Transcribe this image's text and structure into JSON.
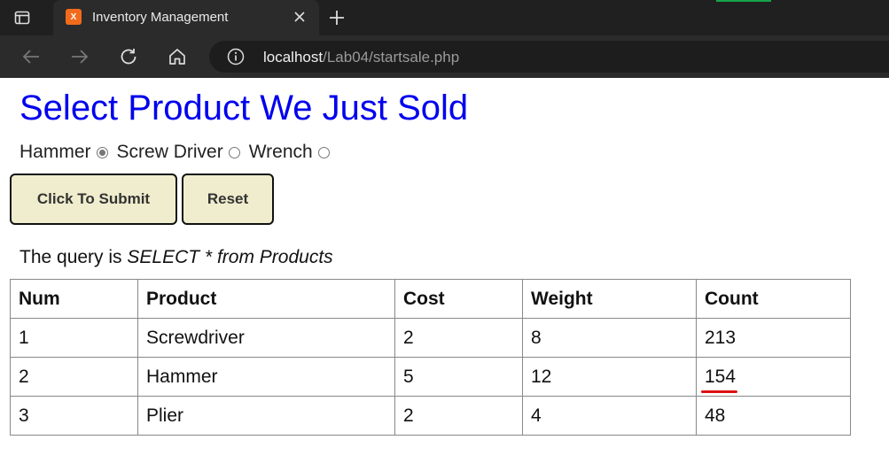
{
  "browser": {
    "tab_title": "Inventory Management",
    "favicon_text": "X",
    "url_host": "localhost",
    "url_path": "/Lab04/startsale.php"
  },
  "page": {
    "heading": "Select Product We Just Sold",
    "products": [
      {
        "label": "Hammer",
        "checked": true
      },
      {
        "label": "Screw Driver",
        "checked": false
      },
      {
        "label": "Wrench",
        "checked": false
      }
    ],
    "submit_label": "Click To Submit",
    "reset_label": "Reset",
    "query_prefix": "The query is",
    "query_text": "SELECT * from Products"
  },
  "table": {
    "headers": [
      "Num",
      "Product",
      "Cost",
      "Weight",
      "Count"
    ],
    "rows": [
      [
        "1",
        "Screwdriver",
        "2",
        "8",
        "213"
      ],
      [
        "2",
        "Hammer",
        "5",
        "12",
        "154"
      ],
      [
        "3",
        "Plier",
        "2",
        "4",
        "48"
      ]
    ]
  }
}
